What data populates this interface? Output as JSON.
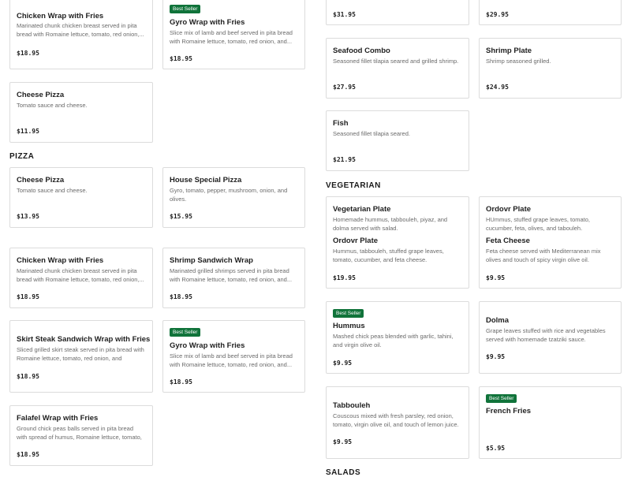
{
  "badge_label": "Best Seller",
  "sections": {
    "pizza": "PIZZA",
    "vegetarian": "VEGETARIAN",
    "salads": "SALADS"
  },
  "items": {
    "chicken_wrap_top": {
      "name": "Chicken Wrap with Fries",
      "desc": "Marinated chunk chicken breast served in pita bread with Romaine lettuce, tomato, red onion,...",
      "price": "$18.95"
    },
    "gyro_wrap_top": {
      "name": "Gyro Wrap with Fries",
      "desc": "Slice mix of lamb and beef served in pita bread with Romaine lettuce, tomato, red onion, and...",
      "price": "$18.95"
    },
    "price_only_1": {
      "price": "$31.95"
    },
    "price_only_2": {
      "price": "$29.95"
    },
    "cheese_pizza_top": {
      "name": "Cheese Pizza",
      "desc": "Tomato sauce and cheese.",
      "price": "$11.95"
    },
    "seafood_combo": {
      "name": "Seafood Combo",
      "desc": "Seasoned fillet tilapia seared and grilled shrimp.",
      "price": "$27.95"
    },
    "shrimp_plate": {
      "name": "Shrimp Plate",
      "desc": "Shrimp seasoned grilled.",
      "price": "$24.95"
    },
    "fish": {
      "name": "Fish",
      "desc": "Seasoned fillet tilapia seared.",
      "price": "$21.95"
    },
    "cheese_pizza": {
      "name": "Cheese Pizza",
      "desc": "Tomato sauce and cheese.",
      "price": "$13.95"
    },
    "house_special_pizza": {
      "name": "House Special Pizza",
      "desc": "Gyro, tomato, pepper, mushroom, onion, and olives.",
      "price": "$15.95"
    },
    "vegetarian_plate": {
      "name": "Vegetarian Plate",
      "desc": "Homemade hummus, tabbouleh, piyaz, and dolma served with salad."
    },
    "ordovr_plate_right": {
      "name": "Ordovr Plate",
      "desc": "HUmmus, stuffed grape leaves, tomato, cucumber, feta, olives, and tabouleh."
    },
    "ordovr_plate": {
      "name": "Ordovr Plate",
      "desc": "Hummus, tabbouleh, stuffed grape leaves, tomato, cucumber, and feta cheese.",
      "price": "$19.95"
    },
    "feta_cheese": {
      "name": "Feta Cheese",
      "desc": "Feta cheese served with Mediterranean mix olives and touch of spicy virgin olive oil.",
      "price": "$9.95"
    },
    "chicken_wrap": {
      "name": "Chicken Wrap with Fries",
      "desc": "Marinated chunk chicken breast served in pita bread with Romaine lettuce, tomato, red onion,...",
      "price": "$18.95"
    },
    "shrimp_sandwich_wrap": {
      "name": "Shrimp Sandwich Wrap",
      "desc": "Marinated grilled shrimps served in pita bread with Romaine lettuce, tomato, red onion, and...",
      "price": "$18.95"
    },
    "hummus": {
      "name": "Hummus",
      "desc": "Mashed chick peas blended with garlic, tahini, and virgin olive oil.",
      "price": "$9.95"
    },
    "dolma": {
      "name": "Dolma",
      "desc": "Grape leaves stuffed with rice and vegetables served with homemade tzatziki sauce.",
      "price": "$9.95"
    },
    "skirt_steak_wrap": {
      "name": "Skirt Steak Sandwich Wrap with Fries",
      "desc": "Sliced grilled skirt steak served in pita bread with Romaine lettuce, tomato, red onion, and tzatziki...",
      "price": "$18.95"
    },
    "gyro_wrap": {
      "name": "Gyro Wrap with Fries",
      "desc": "Slice mix of lamb and beef served in pita bread with Romaine lettuce, tomato, red onion, and...",
      "price": "$18.95"
    },
    "tabbouleh": {
      "name": "Tabbouleh",
      "desc": "Couscous mixed with fresh parsley, red onion, tomato, virgin olive oil, and touch of lemon juice.",
      "price": "$9.95"
    },
    "french_fries": {
      "name": "French Fries",
      "price": "$5.95"
    },
    "falafel_wrap": {
      "name": "Falafel Wrap with Fries",
      "desc": "Ground chick peas balls served in pita bread with spread of humus, Romaine lettuce, tomato, red...",
      "price": "$18.95"
    }
  }
}
